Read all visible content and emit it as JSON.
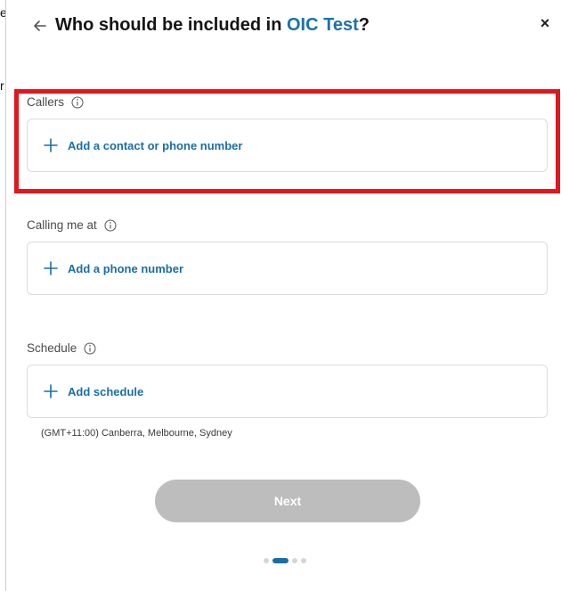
{
  "background": {
    "chars": [
      "e",
      "r"
    ]
  },
  "header": {
    "title_prefix": "Who should be included in ",
    "title_accent": "OIC Test",
    "title_suffix": "?",
    "close_symbol": "×"
  },
  "sections": [
    {
      "label": "Callers",
      "action": "Add a contact or phone number"
    },
    {
      "label": "Calling me at",
      "action": "Add a phone number"
    },
    {
      "label": "Schedule",
      "action": "Add schedule"
    }
  ],
  "timezone": "(GMT+11:00) Canberra, Melbourne, Sydney",
  "next_label": "Next",
  "pagination": {
    "total": 4,
    "current": 2
  },
  "colors": {
    "accent": "#1a73a8",
    "link": "#1a6ea6",
    "highlight": "#e3151d",
    "disabled_button": "#bdbdbd"
  }
}
